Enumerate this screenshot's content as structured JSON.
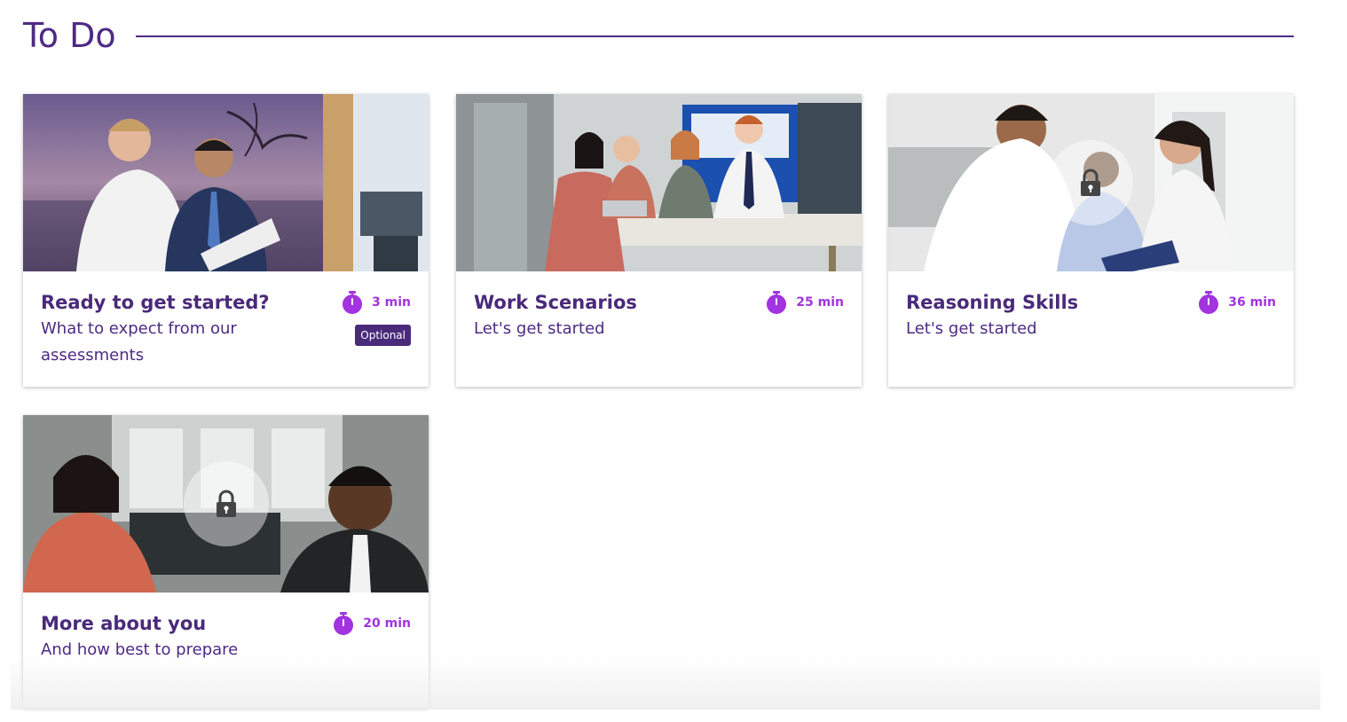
{
  "page": {
    "title": "To Do"
  },
  "colors": {
    "brand_purple": "#4e2a84",
    "accent_purple": "#a233e0",
    "badge_bg": "#4a2a7a"
  },
  "cards": [
    {
      "title": "Ready to get started?",
      "subtitle": "What to expect from our assessments",
      "duration": "3 min",
      "badge": "Optional",
      "locked": false,
      "icon": "stopwatch-icon"
    },
    {
      "title": "Work Scenarios",
      "subtitle": "Let's get started",
      "duration": "25 min",
      "locked": false,
      "icon": "stopwatch-icon"
    },
    {
      "title": "Reasoning Skills",
      "subtitle": "Let's get started",
      "duration": "36 min",
      "locked": true,
      "icon": "stopwatch-icon"
    },
    {
      "title": "More about you",
      "subtitle": "And how best to prepare",
      "duration": "20 min",
      "locked": true,
      "icon": "stopwatch-icon"
    }
  ]
}
